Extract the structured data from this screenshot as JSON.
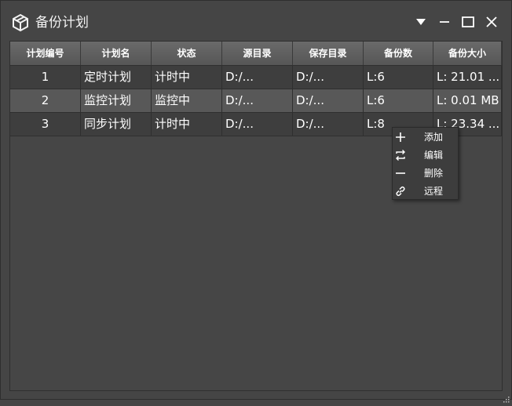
{
  "window": {
    "title": "备份计划",
    "icons": [
      "app-logo-icon",
      "dropdown-icon",
      "minimize-icon",
      "maximize-icon",
      "close-icon"
    ]
  },
  "table": {
    "columns": [
      "计划编号",
      "计划名",
      "状态",
      "源目录",
      "保存目录",
      "备份数",
      "备份大小"
    ],
    "rows": [
      [
        "1",
        "定时计划",
        "计时中",
        "D:/...",
        "D:/...",
        "L:6",
        "L: 21.01 ..."
      ],
      [
        "2",
        "监控计划",
        "监控中",
        "D:/...",
        "D:/...",
        "L:6",
        "L: 0.01 MB"
      ],
      [
        "3",
        "同步计划",
        "计时中",
        "D:/...",
        "D:/...",
        "L:8",
        "L: 23.34 ..."
      ]
    ]
  },
  "context_menu": {
    "items": [
      {
        "label": "添加",
        "icon": "plus-icon"
      },
      {
        "label": "编辑",
        "icon": "swap-icon"
      },
      {
        "label": "删除",
        "icon": "minus-icon"
      },
      {
        "label": "远程",
        "icon": "link-icon"
      }
    ]
  },
  "colors": {
    "background": "#454545",
    "header": "#606060",
    "row_dark": "#3e3e3e",
    "row_light": "#585858",
    "menu": "#3d3d3d"
  }
}
